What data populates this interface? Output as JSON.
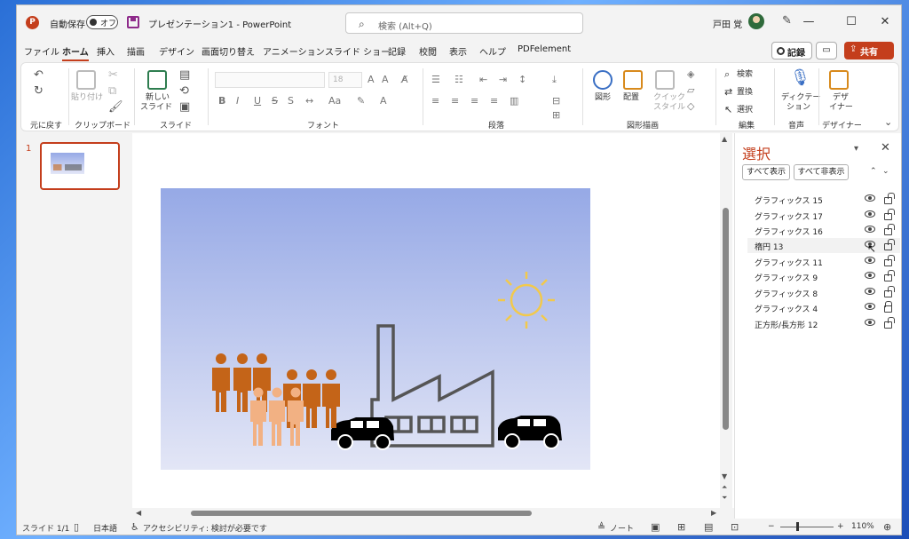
{
  "titlebar": {
    "app_logo": "P",
    "autosave_label": "自動保存",
    "autosave_state": "オフ",
    "doc_title": "プレゼンテーション1  -  PowerPoint",
    "search_placeholder": "検索 (Alt+Q)",
    "user_name": "戸田 覚",
    "minimize": "—",
    "maximize": "☐",
    "close": "✕"
  },
  "menu": {
    "tabs": [
      "ファイル",
      "ホーム",
      "挿入",
      "描画",
      "デザイン",
      "画面切り替え",
      "アニメーション",
      "スライド ショー",
      "記録",
      "校閲",
      "表示",
      "ヘルプ",
      "PDFelement"
    ],
    "active_tab": "ホーム",
    "record_label": "記録",
    "share_label": "共有"
  },
  "ribbon": {
    "groups": [
      "元に戻す",
      "クリップボード",
      "スライド",
      "フォント",
      "段落",
      "図形描画",
      "編集",
      "音声",
      "デザイナー"
    ],
    "paste_label": "貼り付け",
    "new_slide_label_1": "新しい",
    "new_slide_label_2": "スライド",
    "font_name": "",
    "font_size": "18",
    "shape_label": "図形",
    "arrange_label": "配置",
    "quick_style_label_1": "クイック",
    "quick_style_label_2": "スタイル",
    "find_label": "検索",
    "replace_label": "置換",
    "select_label": "選択",
    "dictate_label_1": "ディクテー",
    "dictate_label_2": "ション",
    "designer_label_1": "デザ",
    "designer_label_2": "イナー",
    "bold": "B",
    "italic": "I",
    "underline": "U",
    "strike": "S"
  },
  "thumbnails": {
    "slide_number": "1"
  },
  "selection_pane": {
    "title": "選択",
    "show_all": "すべて表示",
    "hide_all": "すべて非表示",
    "items": [
      {
        "label": "グラフィックス 15",
        "locked": false
      },
      {
        "label": "グラフィックス 17",
        "locked": false
      },
      {
        "label": "グラフィックス 16",
        "locked": false
      },
      {
        "label": "楕円 13",
        "locked": false
      },
      {
        "label": "グラフィックス 11",
        "locked": false
      },
      {
        "label": "グラフィックス 9",
        "locked": false
      },
      {
        "label": "グラフィックス 8",
        "locked": false
      },
      {
        "label": "グラフィックス 4",
        "locked": true
      },
      {
        "label": "正方形/長方形 12",
        "locked": false
      }
    ]
  },
  "statusbar": {
    "slide_info": "スライド 1/1",
    "language": "日本語",
    "accessibility": "アクセシビリティ: 検討が必要です",
    "notes": "ノート",
    "zoom_level": "110%",
    "zoom_minus": "−",
    "zoom_plus": "+"
  },
  "colors": {
    "accent": "#c43e1c",
    "people_dark": "#c46418",
    "people_light": "#f2b183",
    "factory": "#555555",
    "sun": "#f2c94c",
    "car": "#000000"
  }
}
